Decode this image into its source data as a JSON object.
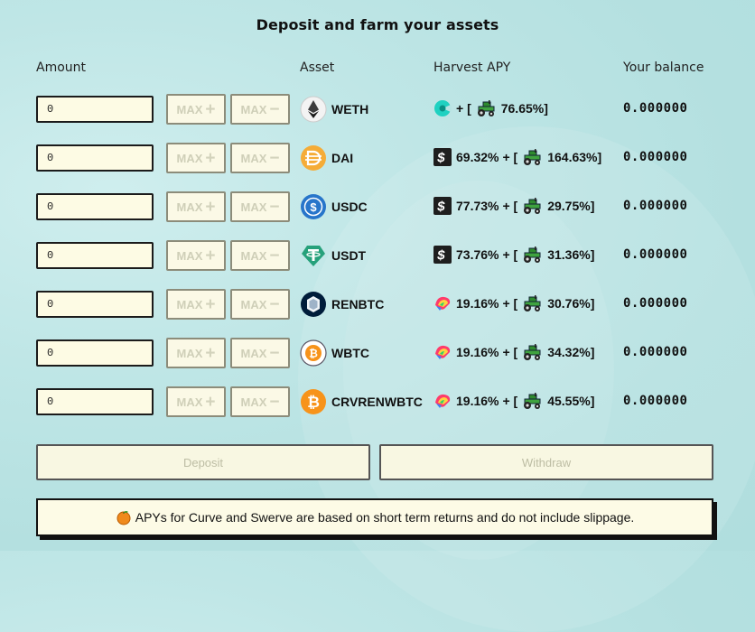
{
  "title": "Deposit and farm your assets",
  "headers": {
    "amount": "Amount",
    "asset": "Asset",
    "apy": "Harvest APY",
    "balance": "Your balance"
  },
  "max_label": "MAX",
  "rows": [
    {
      "amount": "0",
      "asset": "WETH",
      "asset_icon": "ethereum-icon",
      "apy_icon": "pacman-icon",
      "apy_base": "",
      "apy_prefix": "+ [",
      "apy_farm": "76.65%]",
      "balance": "0.000000"
    },
    {
      "amount": "0",
      "asset": "DAI",
      "asset_icon": "dai-icon",
      "apy_icon": "dollar-icon",
      "apy_base": "69.32%",
      "apy_prefix": "+ [",
      "apy_farm": "164.63%]",
      "balance": "0.000000"
    },
    {
      "amount": "0",
      "asset": "USDC",
      "asset_icon": "usdc-icon",
      "apy_icon": "dollar-icon",
      "apy_base": "77.73%",
      "apy_prefix": "+ [",
      "apy_farm": "29.75%]",
      "balance": "0.000000"
    },
    {
      "amount": "0",
      "asset": "USDT",
      "asset_icon": "tether-icon",
      "apy_icon": "dollar-icon",
      "apy_base": "73.76%",
      "apy_prefix": "+ [",
      "apy_farm": "31.36%]",
      "balance": "0.000000"
    },
    {
      "amount": "0",
      "asset": "RENBTC",
      "asset_icon": "renbtc-icon",
      "apy_icon": "curve-icon",
      "apy_base": "19.16%",
      "apy_prefix": "+ [",
      "apy_farm": "30.76%]",
      "balance": "0.000000"
    },
    {
      "amount": "0",
      "asset": "WBTC",
      "asset_icon": "wbtc-icon",
      "apy_icon": "curve-icon",
      "apy_base": "19.16%",
      "apy_prefix": "+ [",
      "apy_farm": "34.32%]",
      "balance": "0.000000"
    },
    {
      "amount": "0",
      "asset": "CRVRENWBTC",
      "asset_icon": "bitcoin-icon",
      "apy_icon": "curve-icon",
      "apy_base": "19.16%",
      "apy_prefix": "+ [",
      "apy_farm": "45.55%]",
      "balance": "0.000000"
    }
  ],
  "buttons": {
    "deposit": "Deposit",
    "withdraw": "Withdraw"
  },
  "notice": {
    "icon": "tangerine-icon",
    "text": "APYs for Curve and Swerve are based on short term returns and do not include slippage."
  },
  "colors": {
    "background": "#b8e3e3",
    "panel": "#fdfbe6",
    "border": "#1b1b1b",
    "disabled_text": "#cfcfb8"
  }
}
